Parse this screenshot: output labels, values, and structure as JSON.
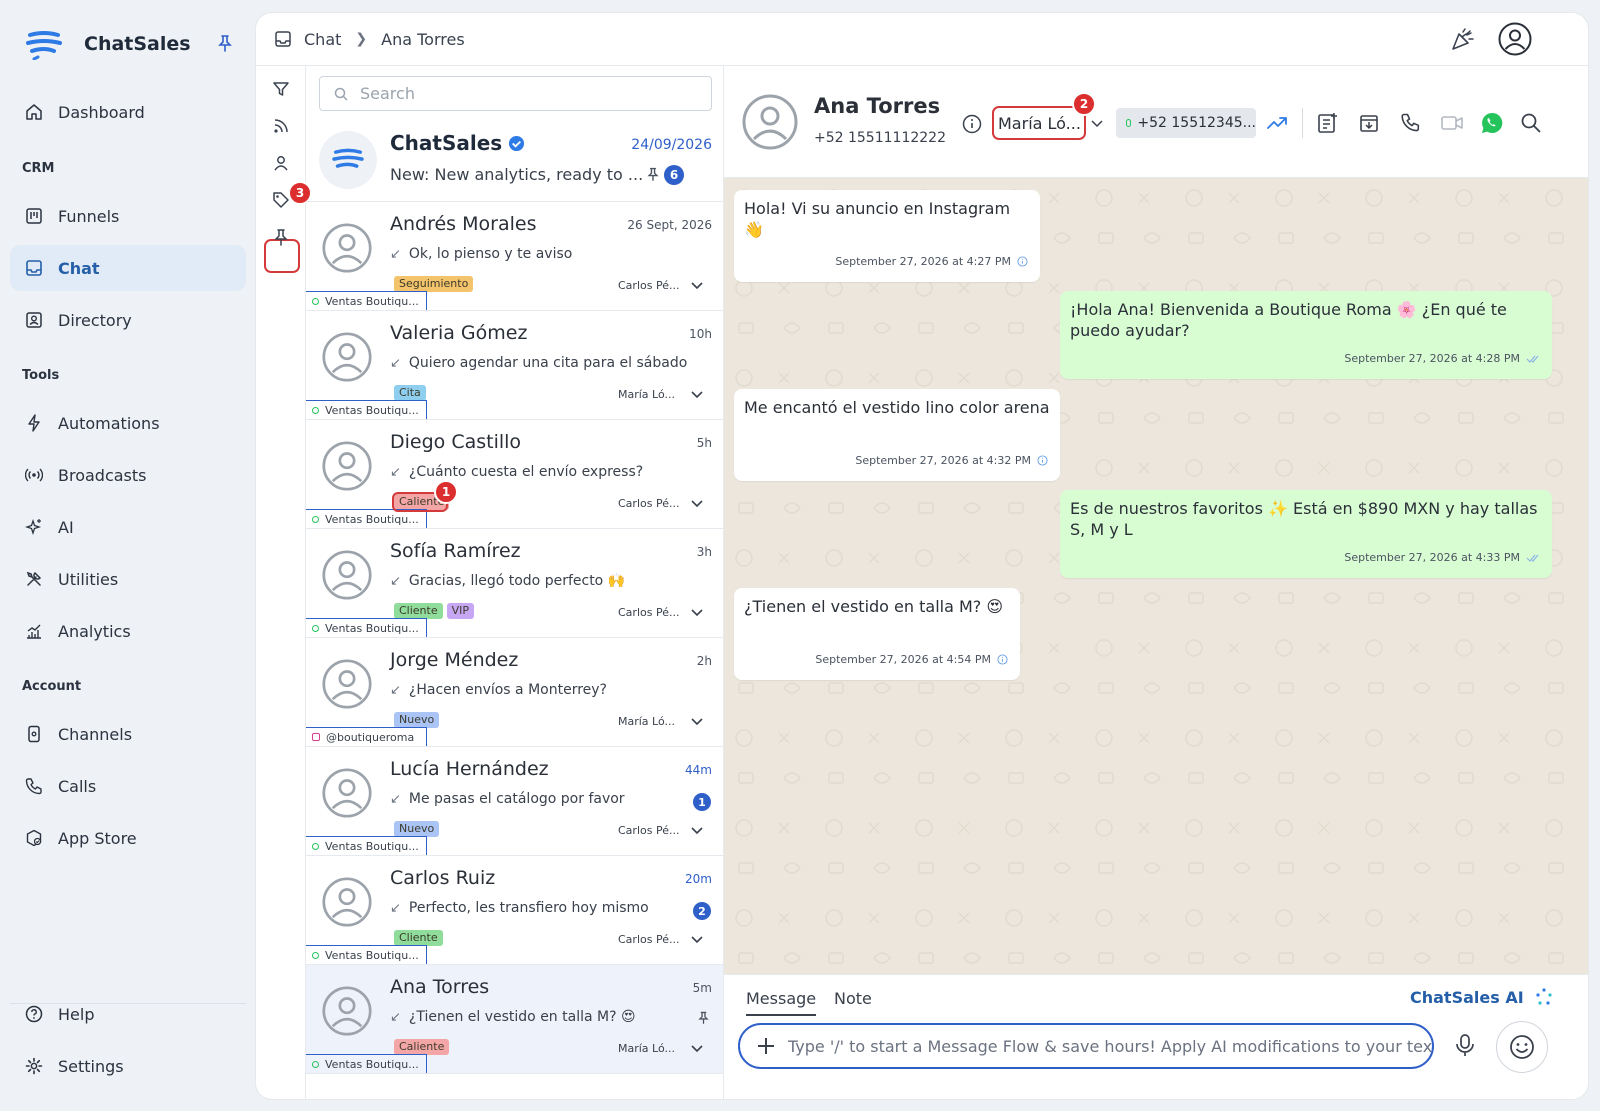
{
  "app": {
    "name": "ChatSales"
  },
  "colors": {
    "accent": "#2f5fc9",
    "active_nav_bg": "#e1ebf7",
    "outgoing_bubble": "#d9fdd3",
    "chat_bg": "#ece6dc",
    "highlight": "#dc2e2e"
  },
  "sidebar": {
    "dashboard": "Dashboard",
    "crm_section": "CRM",
    "funnels": "Funnels",
    "chat": "Chat",
    "directory": "Directory",
    "tools_section": "Tools",
    "automations": "Automations",
    "broadcasts": "Broadcasts",
    "ai": "AI",
    "utilities": "Utilities",
    "analytics": "Analytics",
    "account_section": "Account",
    "channels": "Channels",
    "calls": "Calls",
    "app_store": "App Store",
    "help": "Help",
    "settings": "Settings"
  },
  "breadcrumb": {
    "root": "Chat",
    "current": "Ana Torres"
  },
  "rail": {
    "tag_badge": "3"
  },
  "search": {
    "placeholder": "Search"
  },
  "pinned": {
    "name": "ChatSales",
    "date": "24/09/2026",
    "message": "New: New analytics, ready to ...",
    "unread": "6"
  },
  "conversations": [
    {
      "name": "Andrés Morales",
      "time": "26 Sept, 2026",
      "message": "Ok, lo pienso y te aviso",
      "tags": [
        "Seguimiento"
      ],
      "agent": "Carlos Pé...",
      "channel": "Ventas Boutiqu..."
    },
    {
      "name": "Valeria Gómez",
      "time": "10h",
      "message": "Quiero agendar una cita para el sábado",
      "tags": [
        "Cita"
      ],
      "agent": "María Ló...",
      "channel": "Ventas Boutiqu..."
    },
    {
      "name": "Diego Castillo",
      "time": "5h",
      "message": "¿Cuánto cuesta el envío express?",
      "tags": [
        "Caliente"
      ],
      "tag_badge": "1",
      "agent": "Carlos Pé...",
      "channel": "Ventas Boutiqu..."
    },
    {
      "name": "Sofía Ramírez",
      "time": "3h",
      "message": "Gracias, llegó todo perfecto 🙌",
      "tags": [
        "Cliente",
        "VIP"
      ],
      "agent": "Carlos Pé...",
      "channel": "Ventas Boutiqu..."
    },
    {
      "name": "Jorge Méndez",
      "time": "2h",
      "message": "¿Hacen envíos a Monterrey?",
      "tags": [
        "Nuevo"
      ],
      "agent": "María Ló...",
      "channel": "@boutiqueroma"
    },
    {
      "name": "Lucía Hernández",
      "time": "44m",
      "message": "Me pasas el catálogo por favor",
      "tags": [
        "Nuevo"
      ],
      "unread": "1",
      "agent": "Carlos Pé...",
      "channel": "Ventas Boutiqu..."
    },
    {
      "name": "Carlos Ruiz",
      "time": "20m",
      "message": "Perfecto, les transfiero hoy mismo",
      "tags": [
        "Cliente"
      ],
      "unread": "2",
      "agent": "Carlos Pé...",
      "channel": "Ventas Boutiqu..."
    },
    {
      "name": "Ana Torres",
      "time": "5m",
      "message": "¿Tienen el vestido en talla M? 😍",
      "tags": [
        "Caliente"
      ],
      "agent": "María Ló...",
      "channel": "Ventas Boutiqu..."
    }
  ],
  "chat_header": {
    "name": "Ana Torres",
    "phone": "+52 15511112222",
    "assignee": "María Ló...",
    "assignee_badge": "2",
    "channel_number": "+52 15512345..."
  },
  "messages": [
    {
      "dir": "in",
      "text": "Hola! Vi su anuncio en Instagram 👋",
      "time": "September 27, 2026 at 4:27 PM"
    },
    {
      "dir": "out",
      "text": "¡Hola Ana! Bienvenida a Boutique Roma 🌸 ¿En qué te puedo ayudar?",
      "time": "September 27, 2026 at 4:28 PM"
    },
    {
      "dir": "in",
      "text": "Me encantó el vestido lino color arena",
      "time": "September 27, 2026 at 4:32 PM"
    },
    {
      "dir": "out",
      "text": "Es de nuestros favoritos ✨ Está en $890 MXN y hay tallas S, M y L",
      "time": "September 27, 2026 at 4:33 PM"
    },
    {
      "dir": "in",
      "text": "¿Tienen el vestido en talla M? 😍",
      "time": "September 27, 2026 at 4:54 PM"
    }
  ],
  "composer": {
    "tab_message": "Message",
    "tab_note": "Note",
    "ai_label": "ChatSales AI",
    "placeholder": "Type '/' to start a Message Flow & save hours! Apply AI modifications to your text by"
  }
}
